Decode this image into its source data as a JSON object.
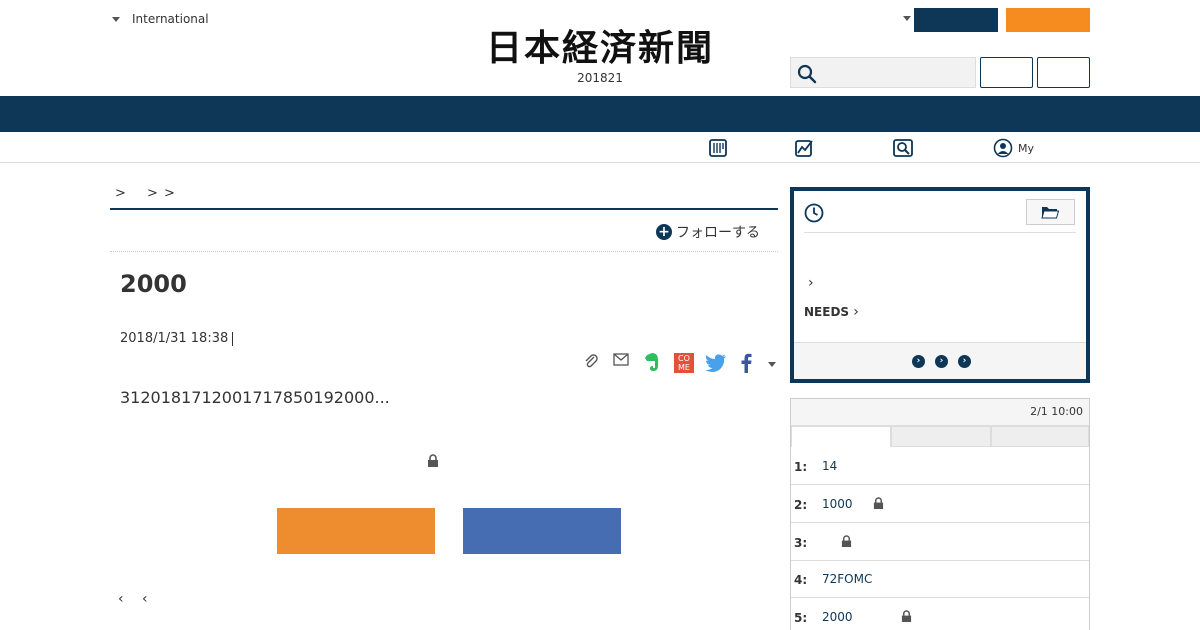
{
  "header": {
    "region_label": "International",
    "logo_text": "日本経済新聞",
    "date_line": "201821",
    "search_placeholder": ""
  },
  "subnav": {
    "items": [
      {
        "icon": "newspaper-icon",
        "label": ""
      },
      {
        "icon": "chart-icon",
        "label": ""
      },
      {
        "icon": "search-icon",
        "label": ""
      },
      {
        "icon": "user-icon",
        "label": "My"
      }
    ]
  },
  "breadcrumb": {
    "separators": [
      ">",
      ">",
      ">"
    ]
  },
  "article": {
    "follow_label": "フォローする",
    "headline": "2000",
    "date": "2018/1/31 18:38",
    "lead": "3120181712001717850192000...",
    "share_icons": [
      "clip-icon",
      "mail-icon",
      "evernote-icon",
      "come-icon",
      "twitter-icon",
      "facebook-icon"
    ],
    "come_text": "CO\nME",
    "nav_prev": "‹",
    "nav_prev2": "‹"
  },
  "sidebar_panel": {
    "chevron": "›",
    "needs_label": "NEEDS",
    "needs_chevron": "›",
    "dot_buttons": [
      "›",
      "›",
      "›"
    ]
  },
  "ranking": {
    "updated": "2/1 10:00",
    "rows": [
      {
        "num": "1:",
        "title": "14",
        "locked": false
      },
      {
        "num": "2:",
        "title": "1000",
        "locked": true
      },
      {
        "num": "3:",
        "title": "",
        "locked": true
      },
      {
        "num": "4:",
        "title": "72FOMC",
        "locked": false
      },
      {
        "num": "5:",
        "title": "2000",
        "locked": true
      }
    ]
  },
  "colors": {
    "navy": "#0d3657",
    "orange": "#f68b1f",
    "cta_orange": "#ee8d2f",
    "cta_blue": "#466db2"
  }
}
